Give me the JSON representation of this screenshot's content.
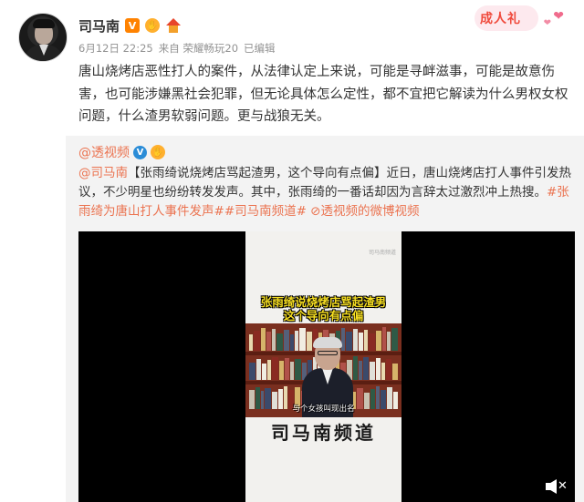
{
  "post": {
    "username": "司马南",
    "badges": [
      "V"
    ],
    "meta": {
      "date": "6月12日 22:25",
      "source": "来自 荣耀畅玩20",
      "edited": "已编辑"
    },
    "sticker_text": "成人礼",
    "content": "唐山烧烤店恶性打人的案件，从法律认定上来说，可能是寻衅滋事，可能是故意伤害，也可能涉嫌黑社会犯罪，但无论具体怎么定性，都不宜把它解读为什么男权女权问题，什么渣男软弱问题。更与战狼无关。"
  },
  "repost": {
    "author": "@透视频",
    "mention": "@司马南",
    "headline": "【张雨绮说烧烤店骂起渣男，这个导向有点偏】",
    "body": "近日，唐山烧烤店打人事件引发热议，不少明星也纷纷转发发声。其中，张雨绮的一番话却因为言辞太过激烈冲上热搜。",
    "hashtag1": "#张雨绮为唐山打人事件发声#",
    "hashtag2": "#司马南频道#",
    "link_icon": "⊘",
    "link_text": "透视频的微博视频"
  },
  "video": {
    "overlay_line1": "张雨绮说烧烤店骂起渣男",
    "overlay_line2": "这个导向有点偏",
    "subtitle": "与个女孩叫现出名",
    "channel": "司马南频道",
    "watermark": "司马南频道"
  },
  "colors": {
    "link": "#eb7350",
    "verified_orange": "#ff8200",
    "verified_blue": "#2a8cd7",
    "repost_bg": "#f3f3f3"
  },
  "icons": [
    "verified-v-icon",
    "hand-badge-icon",
    "house-badge-icon",
    "mute-icon"
  ]
}
